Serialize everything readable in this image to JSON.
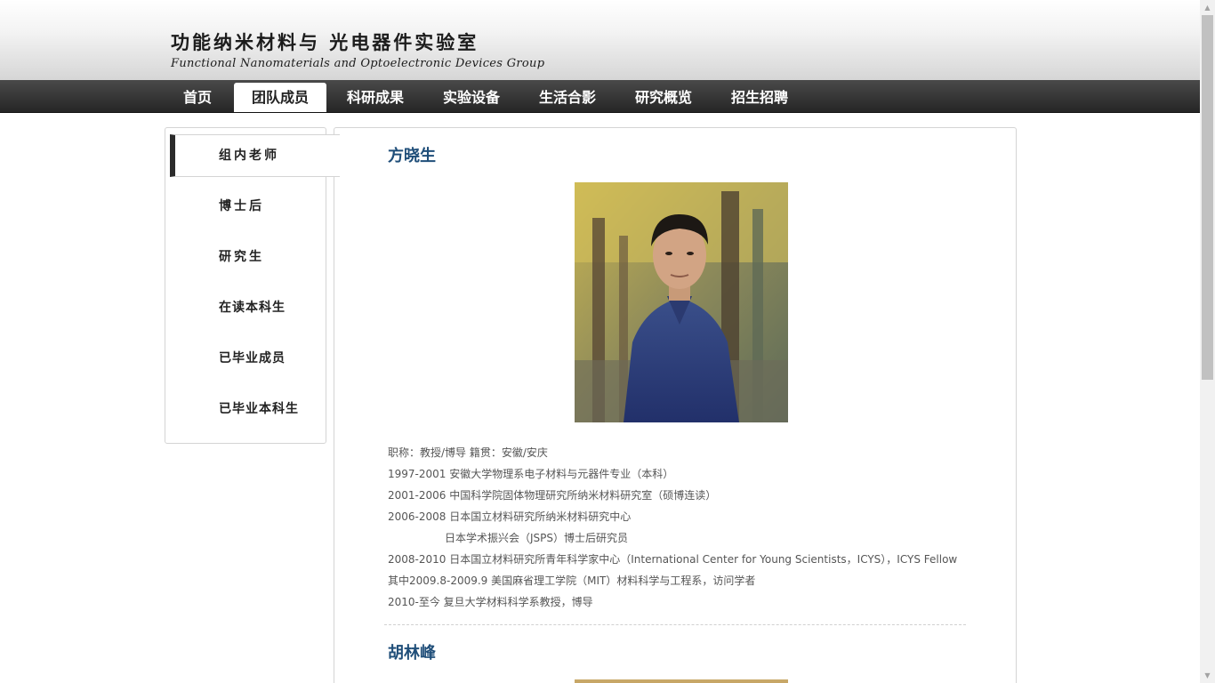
{
  "header": {
    "title_cn": "功能纳米材料与 光电器件实验室",
    "title_en": "Functional Nanomaterials and Optoelectronic Devices Group"
  },
  "nav": {
    "items": [
      {
        "label": "首页",
        "active": false
      },
      {
        "label": "团队成员",
        "active": true
      },
      {
        "label": "科研成果",
        "active": false
      },
      {
        "label": "实验设备",
        "active": false
      },
      {
        "label": "生活合影",
        "active": false
      },
      {
        "label": "研究概览",
        "active": false
      },
      {
        "label": "招生招聘",
        "active": false
      }
    ]
  },
  "sidebar": {
    "items": [
      {
        "label": "组内老师",
        "active": true
      },
      {
        "label": "博士后",
        "active": false
      },
      {
        "label": "研究生",
        "active": false
      },
      {
        "label": "在读本科生",
        "active": false
      },
      {
        "label": "已毕业成员",
        "active": false
      },
      {
        "label": "已毕业本科生",
        "active": false
      }
    ]
  },
  "members": [
    {
      "name": "方晓生",
      "bio": [
        "职称：教授/博导       籍贯：安徽/安庆",
        "1997-2001 安徽大学物理系电子材料与元器件专业（本科）",
        "2001-2006 中国科学院固体物理研究所纳米材料研究室（硕博连读）",
        "2006-2008 日本国立材料研究所纳米材料研究中心",
        "日本学术振兴会（JSPS）博士后研究员",
        "2008-2010 日本国立材料研究所青年科学家中心（International Center for Young Scientists，ICYS），ICYS Fellow",
        "其中2009.8-2009.9 美国麻省理工学院（MIT）材料科学与工程系，访问学者",
        "2010-至今 复旦大学材料科学系教授，博导"
      ]
    },
    {
      "name": "胡林峰",
      "bio": []
    }
  ],
  "colors": {
    "nav_bg": "#333333",
    "name_blue": "#1f4e79",
    "text_gray": "#555555"
  }
}
